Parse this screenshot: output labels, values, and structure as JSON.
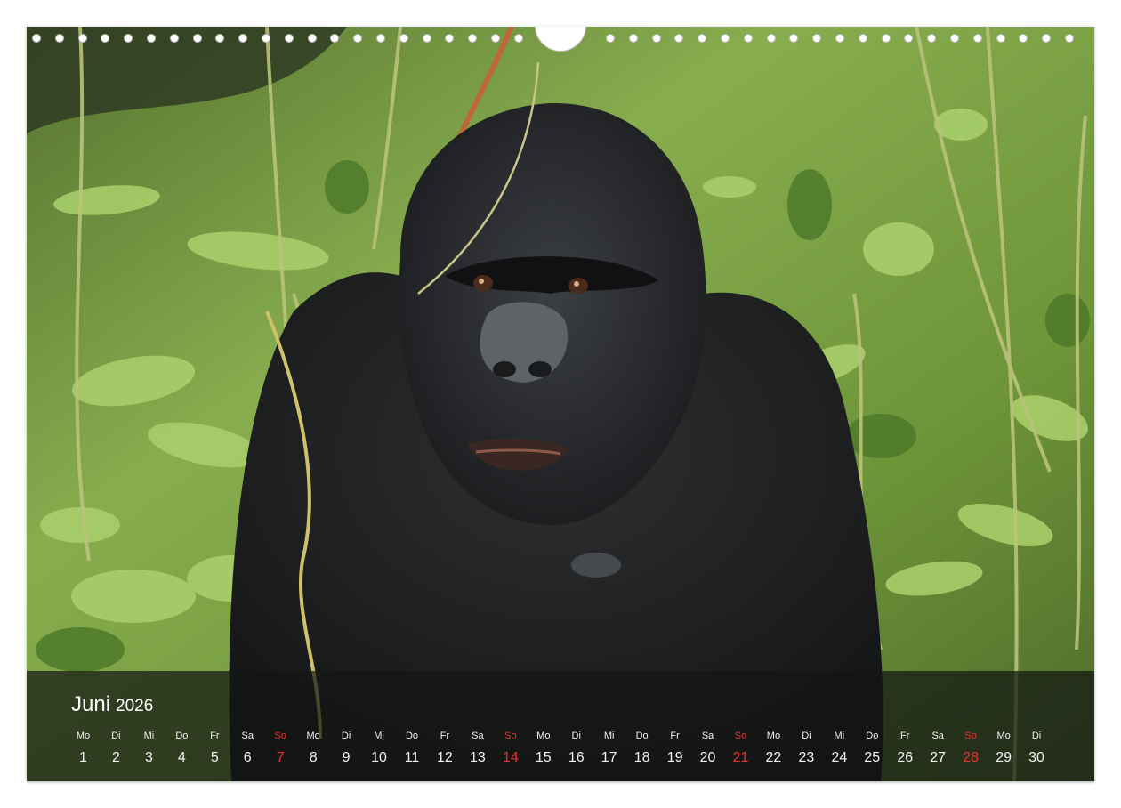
{
  "photo": {
    "subject": "mountain gorilla in green forest",
    "colors": {
      "fur": "#1f2021",
      "foliage": "#6f9a3a",
      "bar": "#141614",
      "sunday": "#e8322f"
    }
  },
  "calendar": {
    "month": "Juni",
    "year": "2026",
    "days": [
      {
        "dow": "Mo",
        "num": "1",
        "sunday": false
      },
      {
        "dow": "Di",
        "num": "2",
        "sunday": false
      },
      {
        "dow": "Mi",
        "num": "3",
        "sunday": false
      },
      {
        "dow": "Do",
        "num": "4",
        "sunday": false
      },
      {
        "dow": "Fr",
        "num": "5",
        "sunday": false
      },
      {
        "dow": "Sa",
        "num": "6",
        "sunday": false
      },
      {
        "dow": "So",
        "num": "7",
        "sunday": true
      },
      {
        "dow": "Mo",
        "num": "8",
        "sunday": false
      },
      {
        "dow": "Di",
        "num": "9",
        "sunday": false
      },
      {
        "dow": "Mi",
        "num": "10",
        "sunday": false
      },
      {
        "dow": "Do",
        "num": "11",
        "sunday": false
      },
      {
        "dow": "Fr",
        "num": "12",
        "sunday": false
      },
      {
        "dow": "Sa",
        "num": "13",
        "sunday": false
      },
      {
        "dow": "So",
        "num": "14",
        "sunday": true
      },
      {
        "dow": "Mo",
        "num": "15",
        "sunday": false
      },
      {
        "dow": "Di",
        "num": "16",
        "sunday": false
      },
      {
        "dow": "Mi",
        "num": "17",
        "sunday": false
      },
      {
        "dow": "Do",
        "num": "18",
        "sunday": false
      },
      {
        "dow": "Fr",
        "num": "19",
        "sunday": false
      },
      {
        "dow": "Sa",
        "num": "20",
        "sunday": false
      },
      {
        "dow": "So",
        "num": "21",
        "sunday": true
      },
      {
        "dow": "Mo",
        "num": "22",
        "sunday": false
      },
      {
        "dow": "Di",
        "num": "23",
        "sunday": false
      },
      {
        "dow": "Mi",
        "num": "24",
        "sunday": false
      },
      {
        "dow": "Do",
        "num": "25",
        "sunday": false
      },
      {
        "dow": "Fr",
        "num": "26",
        "sunday": false
      },
      {
        "dow": "Sa",
        "num": "27",
        "sunday": false
      },
      {
        "dow": "So",
        "num": "28",
        "sunday": true
      },
      {
        "dow": "Mo",
        "num": "29",
        "sunday": false
      },
      {
        "dow": "Di",
        "num": "30",
        "sunday": false
      }
    ]
  }
}
